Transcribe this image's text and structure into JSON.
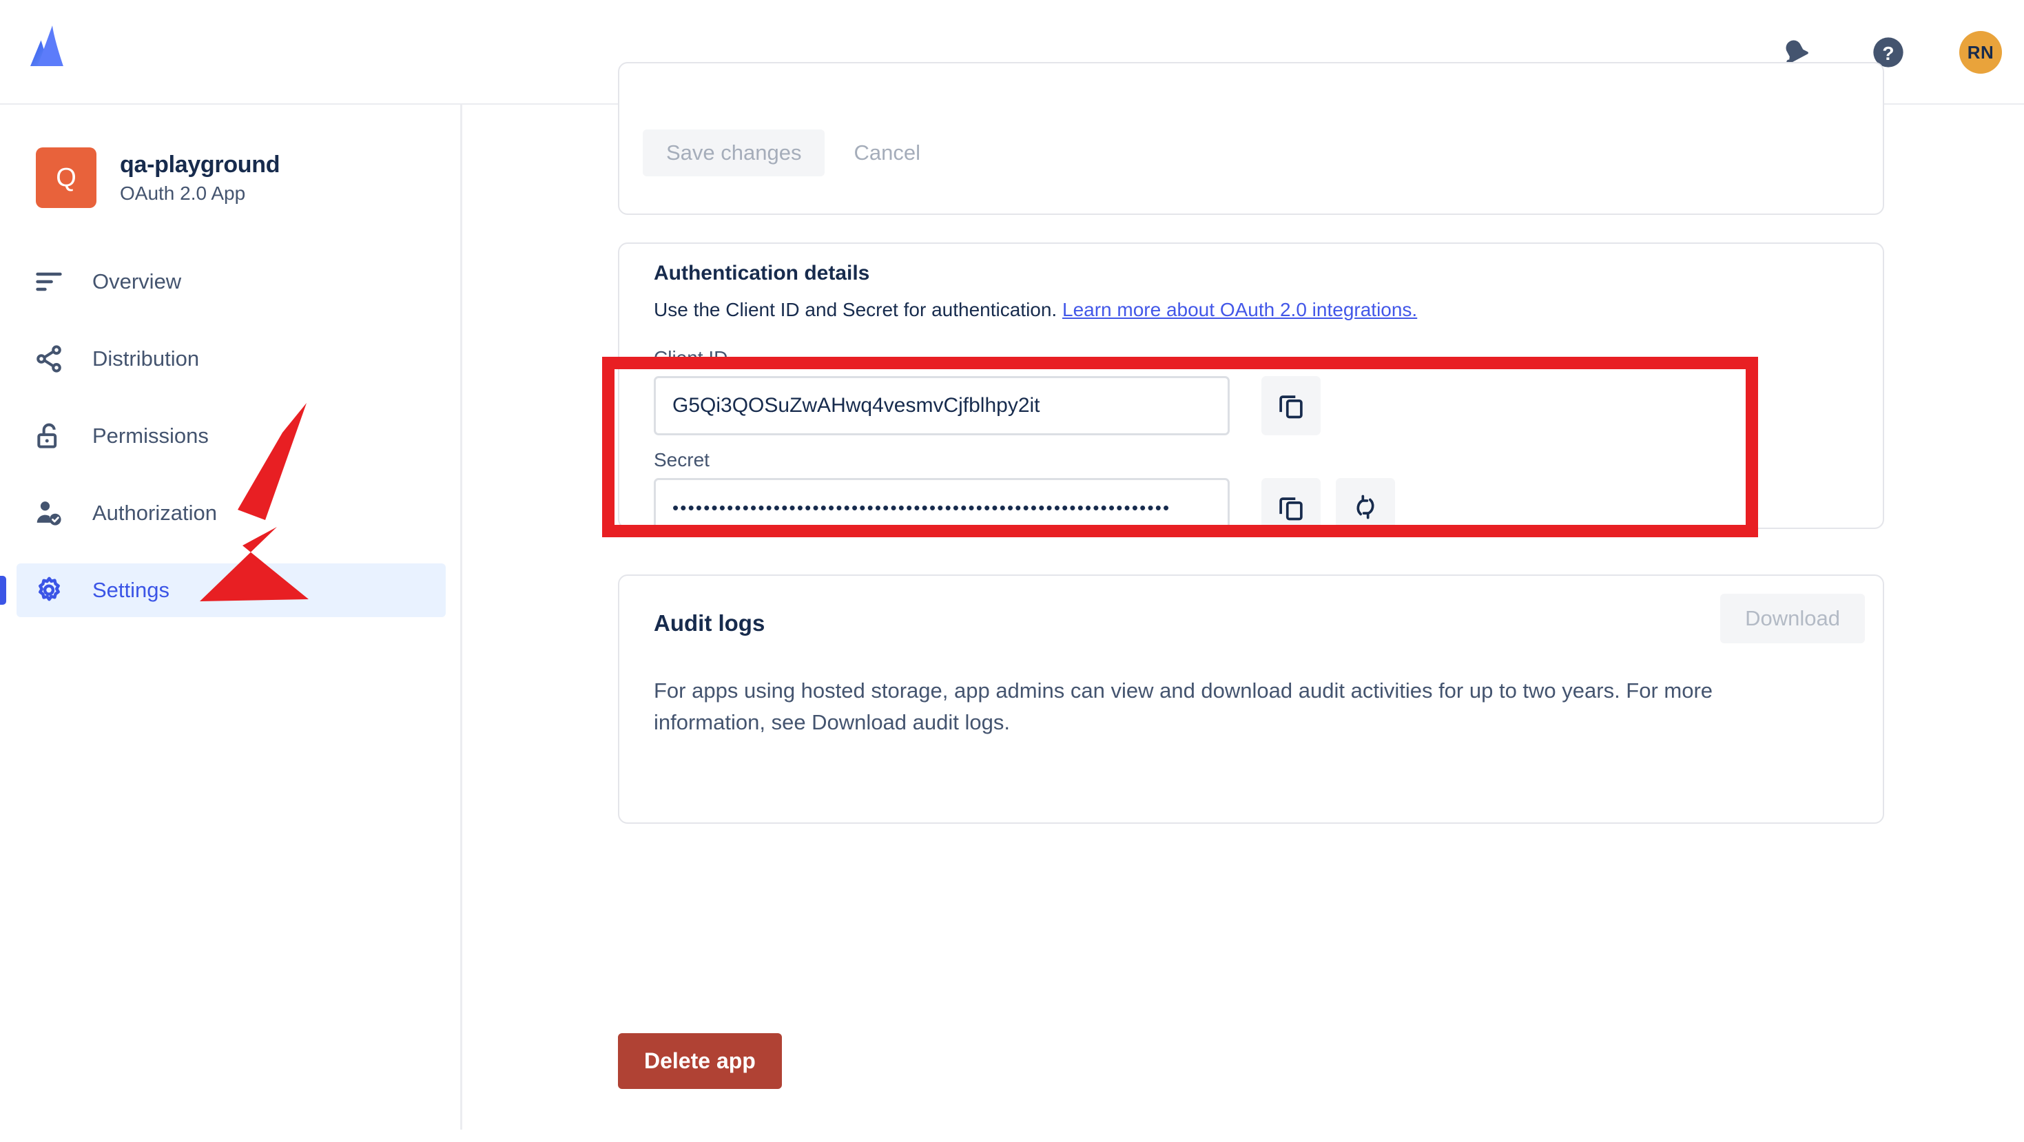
{
  "topbar": {
    "logo": "atlassian-logo",
    "notifications_icon": "bell-icon",
    "help_icon": "help-circle-icon",
    "avatar_initials": "RN"
  },
  "sidebar": {
    "app": {
      "avatar_letter": "Q",
      "name": "qa-playground",
      "type": "OAuth 2.0 App"
    },
    "items": [
      {
        "label": "Overview",
        "icon": "list-icon",
        "active": false
      },
      {
        "label": "Distribution",
        "icon": "share-icon",
        "active": false
      },
      {
        "label": "Permissions",
        "icon": "unlock-icon",
        "active": false
      },
      {
        "label": "Authorization",
        "icon": "user-check-icon",
        "active": false
      },
      {
        "label": "Settings",
        "icon": "gear-icon",
        "active": true
      }
    ]
  },
  "main": {
    "top_card": {
      "save_label": "Save changes",
      "cancel_label": "Cancel"
    },
    "auth": {
      "title": "Authentication details",
      "subtitle_text": "Use the Client ID and Secret for authentication.",
      "link_label": "Learn more about OAuth 2.0 integrations.",
      "client_id_label": "Client ID",
      "client_id_value": "G5Qi3QOSuZwAHwq4vesmvCjfblhpy2it",
      "client_id_copy_icon": "copy-icon",
      "secret_label": "Secret",
      "secret_value": "••••••••••••••••••••••••••••••••••••••••••••••••••••••••••••••••",
      "secret_copy_icon": "copy-icon",
      "secret_rotate_icon": "refresh-icon"
    },
    "audit": {
      "title": "Audit logs",
      "download_label": "Download",
      "body": "For apps using hosted storage, app admins can view and download audit activities for up to two years. For more information, see Download audit logs."
    },
    "delete_label": "Delete app"
  },
  "annotations": {
    "highlight_color": "#e81f23",
    "arrow_target": "sidebar-item-settings",
    "box_target": "authentication-credentials"
  },
  "colors": {
    "accent_blue": "#3b55e6",
    "link_blue": "#4257e8",
    "app_avatar_orange": "#e8623b",
    "user_avatar_orange": "#e9a33b",
    "danger_red": "#b04234",
    "annotation_red": "#e81f23",
    "text_primary": "#172b4d",
    "text_secondary": "#44546f"
  }
}
